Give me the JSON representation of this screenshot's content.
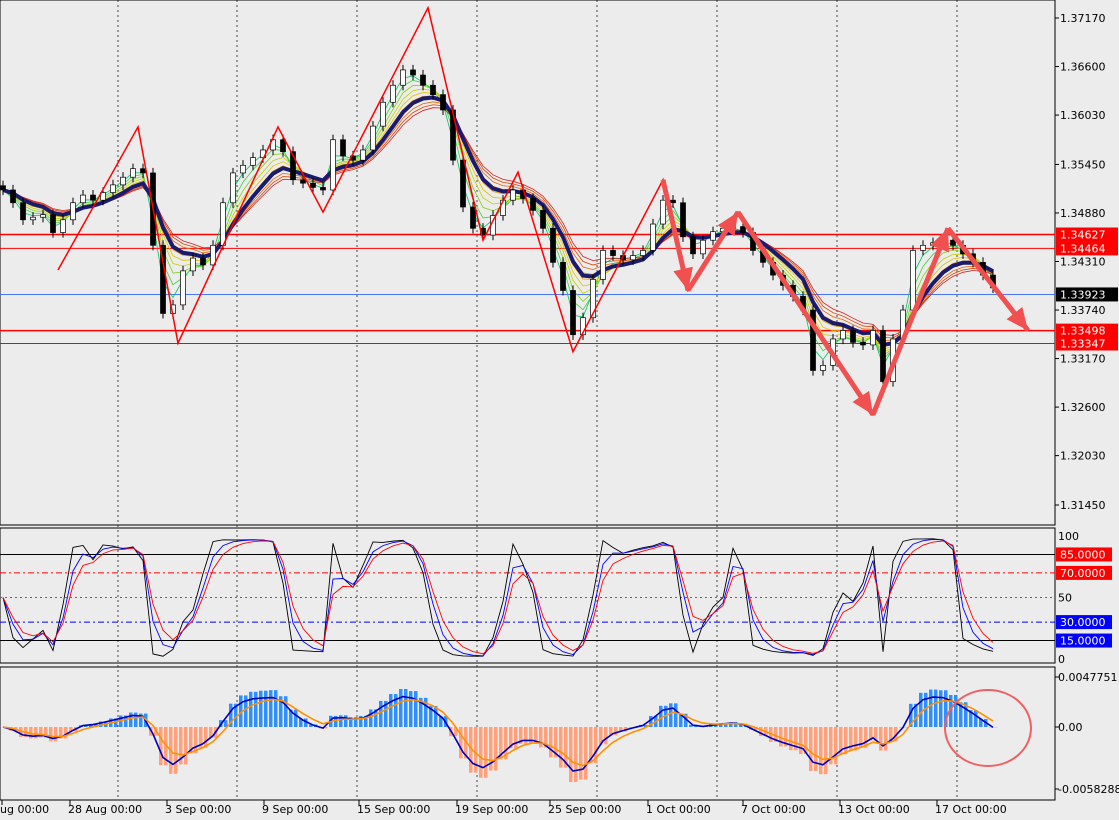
{
  "chart_data": [
    {
      "type": "candlestick",
      "panel": "price",
      "grid": "vertical dashed",
      "y_ticks": [
        "1.37170",
        "1.36600",
        "1.36030",
        "1.35450",
        "1.34880",
        "1.34310",
        "1.33740",
        "1.33170",
        "1.32600",
        "1.32030",
        "1.31450"
      ],
      "ylim": [
        1.311,
        1.3737
      ],
      "closes": [
        1.3515,
        1.35,
        1.348,
        1.3483,
        1.3486,
        1.3465,
        1.348,
        1.35,
        1.3509,
        1.3503,
        1.3512,
        1.3521,
        1.353,
        1.354,
        1.3535,
        1.345,
        1.337,
        1.338,
        1.342,
        1.3435,
        1.3427,
        1.345,
        1.35,
        1.3535,
        1.3544,
        1.3553,
        1.3562,
        1.3574,
        1.356,
        1.3527,
        1.3523,
        1.3518,
        1.3515,
        1.3574,
        1.3555,
        1.355,
        1.3562,
        1.359,
        1.3618,
        1.3638,
        1.3656,
        1.365,
        1.3638,
        1.3627,
        1.3609,
        1.355,
        1.3495,
        1.347,
        1.3462,
        1.3485,
        1.3503,
        1.3515,
        1.3505,
        1.3491,
        1.347,
        1.343,
        1.3397,
        1.3345,
        1.3365,
        1.341,
        1.3444,
        1.3438,
        1.3433,
        1.3438,
        1.3444,
        1.3475,
        1.3503,
        1.35,
        1.346,
        1.344,
        1.3456,
        1.3466,
        1.347,
        1.3472,
        1.3465,
        1.3444,
        1.343,
        1.3415,
        1.3403,
        1.339,
        1.3374,
        1.3303,
        1.3309,
        1.334,
        1.335,
        1.3336,
        1.3333,
        1.335,
        1.329,
        1.334,
        1.3374,
        1.3444,
        1.345,
        1.3453,
        1.3456,
        1.345,
        1.344,
        1.343,
        1.3415,
        1.34
      ],
      "zigzag": [
        [
          5.5,
          1.3421
        ],
        [
          13.5,
          1.3589
        ],
        [
          17.5,
          1.3335
        ],
        [
          27.5,
          1.3589
        ],
        [
          32,
          1.3489
        ],
        [
          42.5,
          1.3729
        ],
        [
          48,
          1.3456
        ],
        [
          51.5,
          1.3536
        ],
        [
          57,
          1.3325
        ],
        [
          66,
          1.3527
        ],
        [
          68.5,
          1.3397
        ],
        [
          73.5,
          1.3489
        ],
        [
          87,
          1.3251
        ],
        [
          94.5,
          1.347
        ],
        [
          102.5,
          1.335
        ]
      ],
      "arrows": [
        [
          [
            66,
            1.3527
          ],
          [
            68.5,
            1.3397
          ]
        ],
        [
          [
            68.5,
            1.3397
          ],
          [
            73.5,
            1.3489
          ]
        ],
        [
          [
            73.5,
            1.3489
          ],
          [
            87,
            1.3251
          ]
        ],
        [
          [
            87,
            1.3251
          ],
          [
            94.5,
            1.347
          ]
        ],
        [
          [
            94.5,
            1.347
          ],
          [
            102.5,
            1.335
          ]
        ]
      ],
      "hlines": [
        {
          "value": "1.34627",
          "color": "#ff0000"
        },
        {
          "value": "1.34464",
          "color": "#ff0000"
        },
        {
          "value": "1.33498",
          "color": "#ff0000"
        },
        {
          "value": "1.33347",
          "color": "#ff0000"
        }
      ],
      "current_price": {
        "value": "1.33923",
        "color": "#000000",
        "line_color": "#3366ff"
      },
      "ma_color": "#1a1a6e"
    },
    {
      "type": "line",
      "panel": "stochastic",
      "ylim": [
        0,
        100
      ],
      "y_ticks": [
        "100",
        "50",
        "0"
      ],
      "levels": [
        {
          "value": "85.0000",
          "color": "#ff0000"
        },
        {
          "value": "70.0000",
          "color": "#ff0000"
        },
        {
          "value": "30.0000",
          "color": "#0000ff"
        },
        {
          "value": "15.0000",
          "color": "#0000ff"
        }
      ]
    },
    {
      "type": "bar",
      "panel": "macd",
      "ylim": [
        -0.0058288,
        0.0047751
      ],
      "y_ticks": [
        "0.0047751",
        "0.00",
        "-0.0058288"
      ],
      "positive_color": "#2e8fff",
      "negative_color": "#ffa07a"
    }
  ],
  "x_ticks": [
    "ug 00:00",
    "28 Aug 00:00",
    "3 Sep 00:00",
    "9 Sep 00:00",
    "15 Sep 00:00",
    "19 Sep 00:00",
    "25 Sep 00:00",
    "1 Oct 00:00",
    "7 Oct 00:00",
    "13 Oct 00:00",
    "17 Oct 00:00"
  ]
}
